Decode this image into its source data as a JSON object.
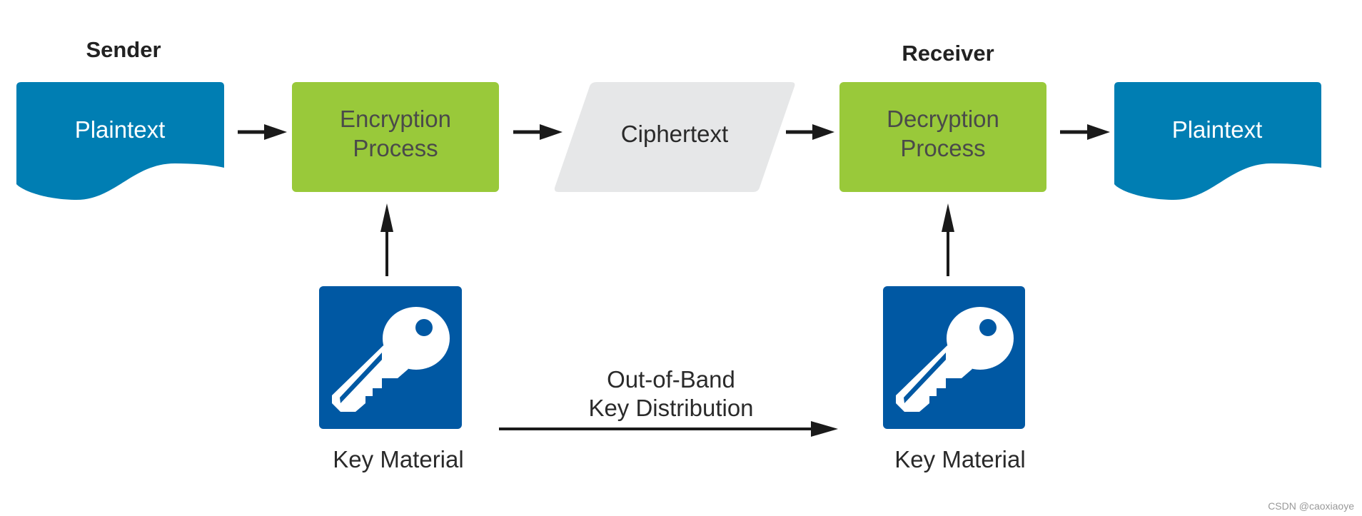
{
  "sender": {
    "title": "Sender"
  },
  "receiver": {
    "title": "Receiver"
  },
  "nodes": {
    "plaintext_in": "Plaintext",
    "encryption": [
      "Encryption",
      "Process"
    ],
    "ciphertext": "Ciphertext",
    "decryption": [
      "Decryption",
      "Process"
    ],
    "plaintext_out": "Plaintext"
  },
  "keys": {
    "sender_label": "Key Material",
    "receiver_label": "Key Material",
    "icon": "key-icon"
  },
  "distribution": [
    "Out-of-Band",
    "Key Distribution"
  ],
  "watermark": "CSDN @caoxiaoye",
  "colors": {
    "plaintext": "#007eb3",
    "process": "#99c93a",
    "ciphertext": "#e6e7e8",
    "key_box": "#0058a3",
    "arrow": "#1a1a1a"
  }
}
